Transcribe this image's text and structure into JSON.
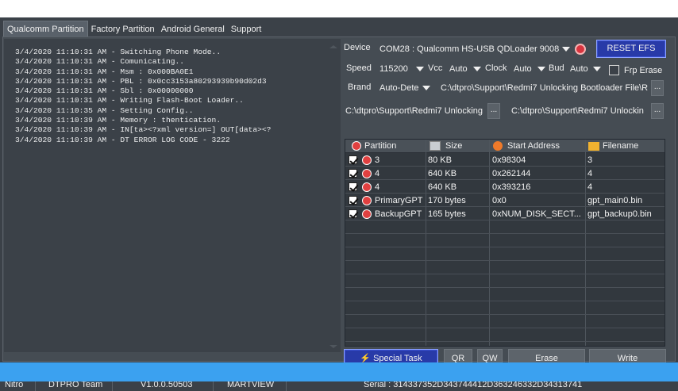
{
  "tabs": [
    "Qualcomm Partition",
    "Factory Partition",
    "Android General",
    "Support"
  ],
  "log_lines": [
    "3/4/2020 11:10:31 AM - Switching Phone Mode..",
    "3/4/2020 11:10:31 AM - Comunicating..",
    "3/4/2020 11:10:31 AM - Msm : 0x000BA0E1",
    "3/4/2020 11:10:31 AM - PBL : 0x0cc3153a80293939b90d02d3",
    "3/4/2020 11:10:31 AM - Sbl : 0x00000000",
    "3/4/2020 11:10:31 AM - Writing Flash-Boot Loader..",
    "3/4/2020 11:10:35 AM - Setting Config..",
    "3/4/2020 11:10:39 AM - Memory : thentication.",
    "3/4/2020 11:10:39 AM - IN[ta><?xml version=] OUT[data><?",
    "3/4/2020 11:10:39 AM - DT ERROR LOG CODE - 3222"
  ],
  "controls": {
    "device_label": "Device",
    "device_value": "COM28 : Qualcomm HS-USB QDLoader 9008 (",
    "reset_efs_label": "RESET EFS",
    "speed_label": "Speed",
    "speed_value": "115200",
    "vcc_label": "Vcc",
    "vcc_value": "Auto",
    "clock_label": "Clock",
    "clock_value": "Auto",
    "bud_label": "Bud",
    "bud_value": "Auto",
    "frp_label": "Frp Erase",
    "brand_label": "Brand",
    "brand_value": "Auto-Dete",
    "brand_path": "C:\\dtpro\\Support\\Redmi7 Unlocking Bootloader File\\R",
    "path1": "C:\\dtpro\\Support\\Redmi7 Unlocking",
    "path2": "C:\\dtpro\\Support\\Redmi7 Unlockin",
    "browse_label": "..."
  },
  "table": {
    "headers": [
      "Partition",
      "Size",
      "Start Address",
      "Filename"
    ],
    "rows": [
      {
        "partition": "3",
        "size": "80 KB",
        "start": "0x98304",
        "file": "3"
      },
      {
        "partition": "4",
        "size": "640 KB",
        "start": "0x262144",
        "file": "4"
      },
      {
        "partition": "4",
        "size": "640 KB",
        "start": "0x393216",
        "file": "4"
      },
      {
        "partition": "PrimaryGPT",
        "size": "170 bytes",
        "start": "0x0",
        "file": "gpt_main0.bin"
      },
      {
        "partition": "BackupGPT",
        "size": "165 bytes",
        "start": "0xNUM_DISK_SECT...",
        "file": "gpt_backup0.bin"
      }
    ]
  },
  "buttons": {
    "special_task": "Special Task",
    "qr": "QR",
    "qw": "QW",
    "erase": "Erase",
    "write": "Write"
  },
  "footer": {
    "app": "Nitro",
    "team": "DTPRO Team",
    "version": "V1.0.0.50503",
    "author": "MARTVIEW",
    "serial": "Serial : 314337352D343744412D363246332D34313741"
  },
  "colors": {
    "background": "#3b4148",
    "accent_blue": "#3ba1f0",
    "button_blue": "#283aa8"
  }
}
